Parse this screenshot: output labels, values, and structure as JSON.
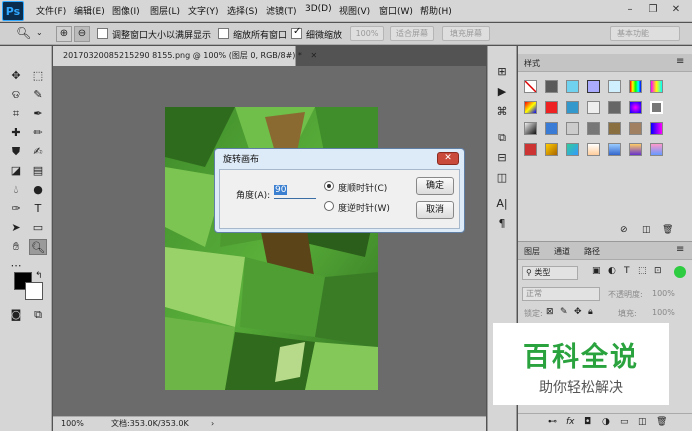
{
  "app": {
    "logo": "Ps"
  },
  "menu": [
    "文件(F)",
    "编辑(E)",
    "图像(I)",
    "图层(L)",
    "文字(Y)",
    "选择(S)",
    "滤镜(T)",
    "3D(D)",
    "视图(V)",
    "窗口(W)",
    "帮助(H)"
  ],
  "options": {
    "resize_window_label": "调整窗口大小以满屏显示",
    "zoom_all_label": "缩放所有窗口",
    "scrubby_label": "细微缩放",
    "zoom_pct": "100%",
    "fit_screen": "适合屏幕",
    "fill_screen": "填充屏幕",
    "workspace": "基本功能"
  },
  "document": {
    "tab_title": "20170320085215290 8155.png @ 100% (图层 0, RGB/8#) *",
    "zoom": "100%",
    "doc_size": "文档:353.0K/353.0K"
  },
  "dialog": {
    "title": "旋转画布",
    "angle_label": "角度(A):",
    "angle_value": "90",
    "cw_label": "度顺时针(C)",
    "ccw_label": "度逆时针(W)",
    "ok": "确定",
    "cancel": "取消"
  },
  "styles_panel": {
    "tab": "样式"
  },
  "layers_panel": {
    "tabs": [
      "图层",
      "通道",
      "路径"
    ],
    "filter": "类型",
    "blend_mode": "正常",
    "opacity_label": "不透明度:",
    "opacity_value": "100%",
    "lock_label": "锁定:",
    "fill_label": "填充:",
    "fill_value": "100%"
  },
  "watermark": {
    "title": "百科全说",
    "subtitle": "助你轻松解决"
  }
}
